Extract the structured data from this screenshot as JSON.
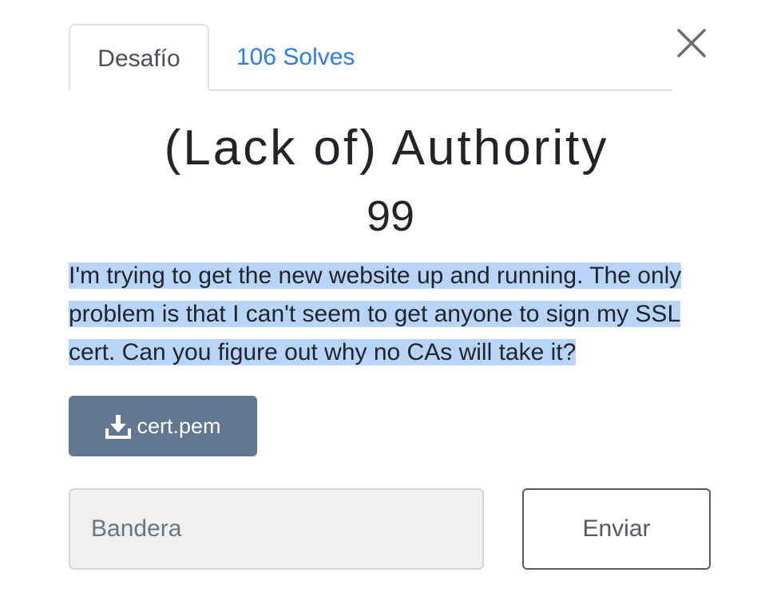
{
  "tabs": {
    "challenge_label": "Desafío",
    "solves_label": "106 Solves"
  },
  "challenge": {
    "name": "(Lack of) Authority",
    "value": "99",
    "description": "I'm trying to get the new website up and running. The only problem is that I can't seem to get anyone to sign my SSL cert. Can you figure out why no CAs will take it?"
  },
  "files": [
    {
      "name": "cert.pem",
      "icon": "download-icon"
    }
  ],
  "form": {
    "flag_placeholder": "Bandera",
    "flag_value": "",
    "submit_label": "Enviar"
  },
  "icons": {
    "close": "close-icon"
  },
  "colors": {
    "accent": "#2d7cf0",
    "download_button": "#627690",
    "selection": "#b8d4f8"
  }
}
